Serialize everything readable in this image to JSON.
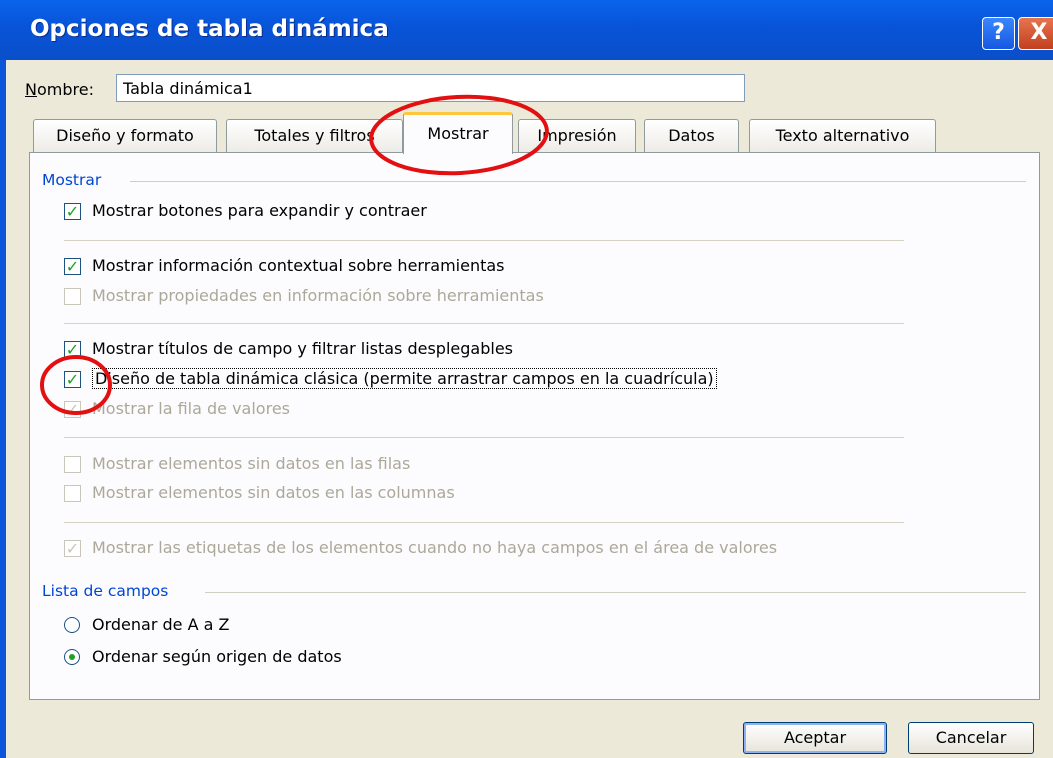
{
  "window": {
    "title": "Opciones de tabla dinámica",
    "help_label": "?",
    "close_label": "X"
  },
  "name_field": {
    "label_prefix": "",
    "label_accel": "N",
    "label_rest": "ombre:",
    "value": "Tabla dinámica1"
  },
  "tabs": [
    {
      "label": "Diseño y formato",
      "active": false
    },
    {
      "label": "Totales y filtros",
      "active": false
    },
    {
      "label": "Mostrar",
      "active": true
    },
    {
      "label": "Impresión",
      "active": false
    },
    {
      "label": "Datos",
      "active": false
    },
    {
      "label": "Texto alternativo",
      "active": false
    }
  ],
  "mostrar_group": {
    "header": "Mostrar",
    "options": [
      {
        "label": "Mostrar botones para expandir y contraer",
        "checked": true,
        "enabled": true
      },
      {
        "label": "Mostrar información contextual sobre herramientas",
        "checked": true,
        "enabled": true
      },
      {
        "label": "Mostrar propiedades en información sobre herramientas",
        "checked": false,
        "enabled": false
      },
      {
        "label": "Mostrar títulos de campo y filtrar listas desplegables",
        "checked": true,
        "enabled": true
      },
      {
        "label": "Diseño de tabla dinámica clásica (permite arrastrar campos en la cuadrícula)",
        "checked": true,
        "enabled": true
      },
      {
        "label": "Mostrar la fila de valores",
        "checked": true,
        "enabled": false
      },
      {
        "label": "Mostrar elementos sin datos en las filas",
        "checked": false,
        "enabled": false
      },
      {
        "label": "Mostrar elementos sin datos en las columnas",
        "checked": false,
        "enabled": false
      },
      {
        "label": "Mostrar las etiquetas de los elementos cuando no haya campos en el área de valores",
        "checked": true,
        "enabled": false
      }
    ]
  },
  "field_list_group": {
    "header": "Lista de campos",
    "options": [
      {
        "label": "Ordenar de A a Z",
        "selected": false
      },
      {
        "label": "Ordenar según origen de datos",
        "selected": true
      }
    ]
  },
  "buttons": {
    "ok": "Aceptar",
    "cancel": "Cancelar"
  },
  "colors": {
    "titlebar": "#0a5ae0",
    "group_header": "#0046d5",
    "annotation_circle": "#e21010",
    "check": "#21a121"
  },
  "check_glyph": "✓"
}
